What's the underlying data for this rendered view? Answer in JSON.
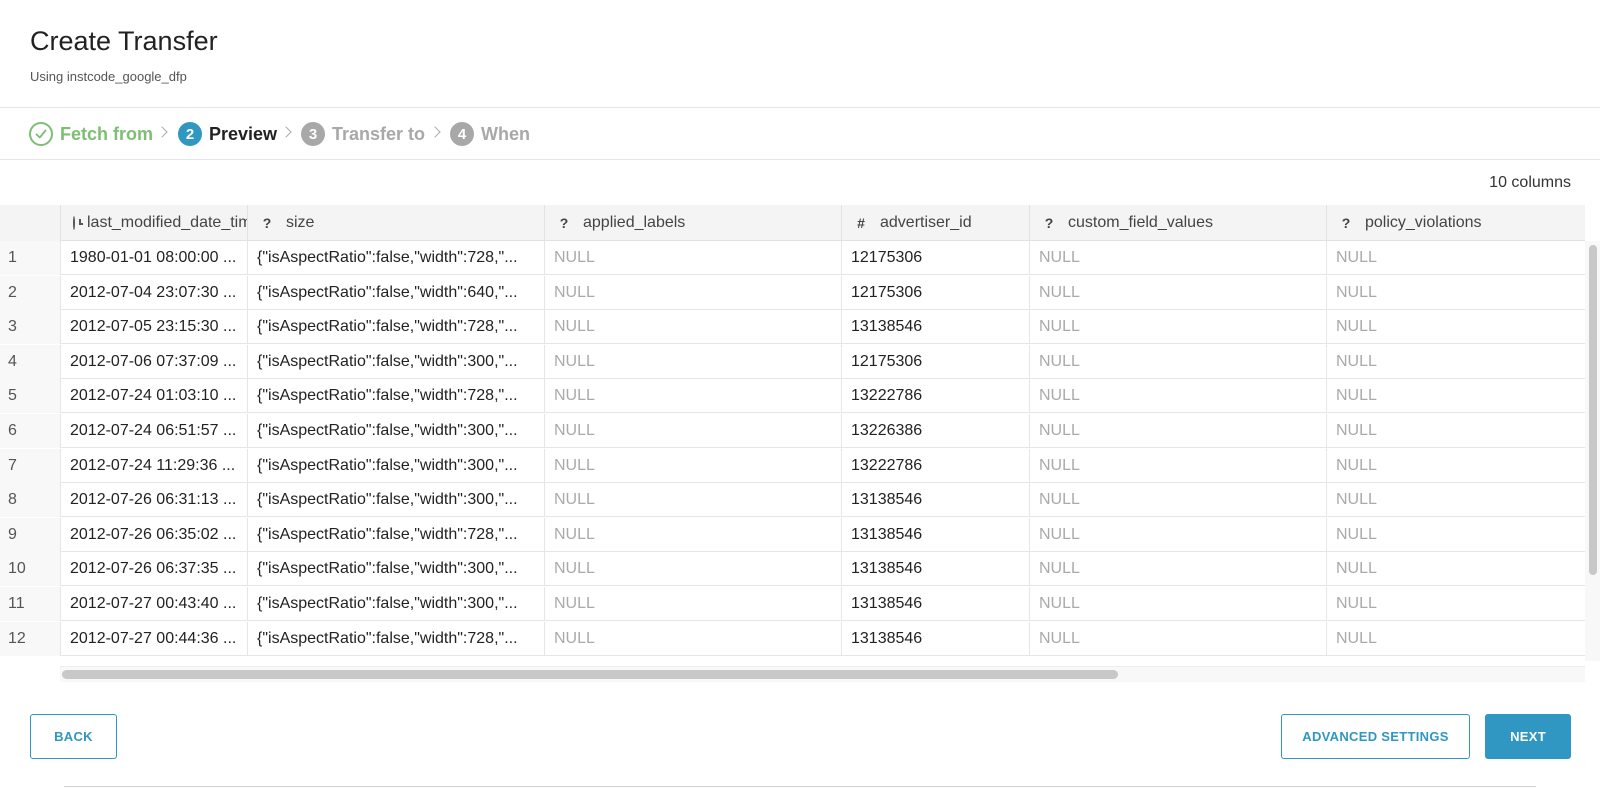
{
  "header": {
    "title": "Create Transfer",
    "subtitle": "Using instcode_google_dfp"
  },
  "steps": [
    {
      "number": "",
      "label": "Fetch from",
      "state": "done",
      "icon": "check-icon"
    },
    {
      "number": "2",
      "label": "Preview",
      "state": "active"
    },
    {
      "number": "3",
      "label": "Transfer to",
      "state": "pending"
    },
    {
      "number": "4",
      "label": "When",
      "state": "pending"
    }
  ],
  "table": {
    "column_count_label": "10 columns",
    "columns": [
      {
        "type_icon": "clock-icon",
        "type_symbol": "",
        "name": "last_modified_date_time"
      },
      {
        "type_icon": "unknown-type-icon",
        "type_symbol": "?",
        "name": "size"
      },
      {
        "type_icon": "unknown-type-icon",
        "type_symbol": "?",
        "name": "applied_labels"
      },
      {
        "type_icon": "number-type-icon",
        "type_symbol": "#",
        "name": "advertiser_id"
      },
      {
        "type_icon": "unknown-type-icon",
        "type_symbol": "?",
        "name": "custom_field_values"
      },
      {
        "type_icon": "unknown-type-icon",
        "type_symbol": "?",
        "name": "policy_violations"
      }
    ],
    "rows": [
      [
        "1",
        "1980-01-01 08:00:00 ...",
        "{\"isAspectRatio\":false,\"width\":728,\"...",
        "NULL",
        "12175306",
        "NULL",
        "NULL"
      ],
      [
        "2",
        "2012-07-04 23:07:30 ...",
        "{\"isAspectRatio\":false,\"width\":640,\"...",
        "NULL",
        "12175306",
        "NULL",
        "NULL"
      ],
      [
        "3",
        "2012-07-05 23:15:30 ...",
        "{\"isAspectRatio\":false,\"width\":728,\"...",
        "NULL",
        "13138546",
        "NULL",
        "NULL"
      ],
      [
        "4",
        "2012-07-06 07:37:09 ...",
        "{\"isAspectRatio\":false,\"width\":300,\"...",
        "NULL",
        "12175306",
        "NULL",
        "NULL"
      ],
      [
        "5",
        "2012-07-24 01:03:10 ...",
        "{\"isAspectRatio\":false,\"width\":728,\"...",
        "NULL",
        "13222786",
        "NULL",
        "NULL"
      ],
      [
        "6",
        "2012-07-24 06:51:57 ...",
        "{\"isAspectRatio\":false,\"width\":300,\"...",
        "NULL",
        "13226386",
        "NULL",
        "NULL"
      ],
      [
        "7",
        "2012-07-24 11:29:36 ...",
        "{\"isAspectRatio\":false,\"width\":300,\"...",
        "NULL",
        "13222786",
        "NULL",
        "NULL"
      ],
      [
        "8",
        "2012-07-26 06:31:13 ...",
        "{\"isAspectRatio\":false,\"width\":300,\"...",
        "NULL",
        "13138546",
        "NULL",
        "NULL"
      ],
      [
        "9",
        "2012-07-26 06:35:02 ...",
        "{\"isAspectRatio\":false,\"width\":728,\"...",
        "NULL",
        "13138546",
        "NULL",
        "NULL"
      ],
      [
        "10",
        "2012-07-26 06:37:35 ...",
        "{\"isAspectRatio\":false,\"width\":300,\"...",
        "NULL",
        "13138546",
        "NULL",
        "NULL"
      ],
      [
        "11",
        "2012-07-27 00:43:40 ...",
        "{\"isAspectRatio\":false,\"width\":300,\"...",
        "NULL",
        "13138546",
        "NULL",
        "NULL"
      ],
      [
        "12",
        "2012-07-27 00:44:36 ...",
        "{\"isAspectRatio\":false,\"width\":728,\"...",
        "NULL",
        "13138546",
        "NULL",
        "NULL"
      ]
    ]
  },
  "footer": {
    "back_label": "BACK",
    "advanced_label": "ADVANCED SETTINGS",
    "next_label": "NEXT"
  },
  "colors": {
    "accent": "#2f97c1",
    "done": "#7cbf72",
    "pending": "#a8a8a8"
  }
}
